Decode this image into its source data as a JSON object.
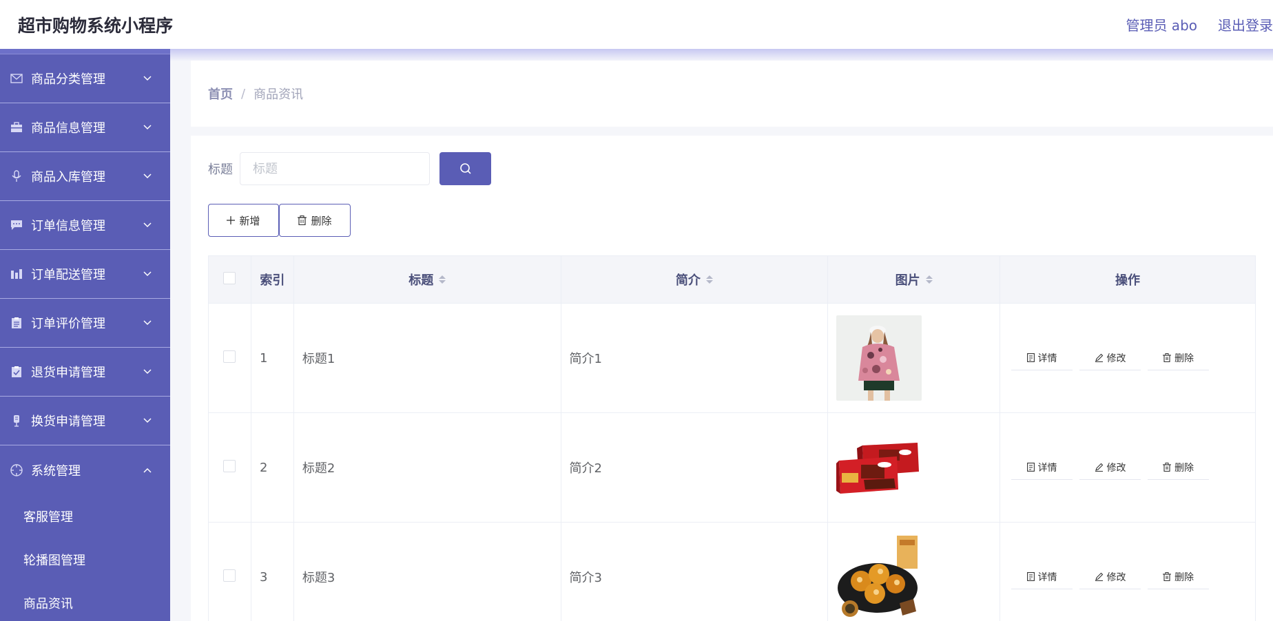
{
  "header": {
    "app_title": "超市购物系统小程序",
    "admin_label": "管理员 abo",
    "logout_label": "退出登录"
  },
  "sidebar": {
    "items": [
      {
        "label": "商品分类管理",
        "icon": "mail-icon",
        "expanded": false
      },
      {
        "label": "商品信息管理",
        "icon": "briefcase-icon",
        "expanded": false
      },
      {
        "label": "商品入库管理",
        "icon": "microphone-icon",
        "expanded": false
      },
      {
        "label": "订单信息管理",
        "icon": "chat-icon",
        "expanded": false
      },
      {
        "label": "订单配送管理",
        "icon": "chart-icon",
        "expanded": false
      },
      {
        "label": "订单评价管理",
        "icon": "clipboard-icon",
        "expanded": false
      },
      {
        "label": "退货申请管理",
        "icon": "checklist-icon",
        "expanded": false
      },
      {
        "label": "换货申请管理",
        "icon": "mic-stand-icon",
        "expanded": false
      },
      {
        "label": "系统管理",
        "icon": "compass-icon",
        "expanded": true
      }
    ],
    "subitems": [
      "客服管理",
      "轮播图管理",
      "商品资讯"
    ]
  },
  "breadcrumb": {
    "home": "首页",
    "separator": "/",
    "current": "商品资讯"
  },
  "search": {
    "label": "标题",
    "placeholder": "标题",
    "value": ""
  },
  "actions": {
    "add_label": "新增",
    "delete_label": "删除"
  },
  "table": {
    "headers": {
      "index": "索引",
      "title": "标题",
      "summary": "简介",
      "image": "图片",
      "ops": "操作"
    },
    "rows": [
      {
        "index": "1",
        "title": "标题1",
        "summary": "简介1",
        "image": "clothing-model-photo"
      },
      {
        "index": "2",
        "title": "标题2",
        "summary": "简介2",
        "image": "chocolate-wafer-boxes-photo"
      },
      {
        "index": "3",
        "title": "标题3",
        "summary": "简介3",
        "image": "pastry-plate-photo"
      }
    ],
    "row_ops": {
      "detail": "详情",
      "edit": "修改",
      "delete": "删除"
    }
  },
  "colors": {
    "primary": "#5a5db5",
    "sidebar_bg": "#5a5db5",
    "header_bg": "#ffffff",
    "page_bg": "#f5f6fa"
  }
}
